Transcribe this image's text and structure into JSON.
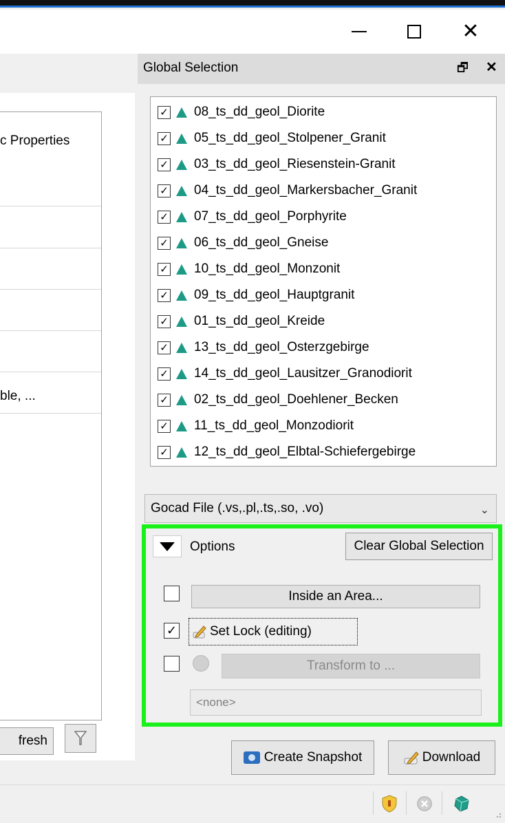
{
  "window": {
    "minimize_glyph": "",
    "maximize_glyph": "",
    "close_glyph": "✕"
  },
  "left_panel": {
    "header_text": "c Properties",
    "row_text": "ble, ...",
    "refresh_label": "fresh"
  },
  "dock": {
    "title": "Global Selection",
    "float_glyph": "🗗",
    "close_glyph": "✕"
  },
  "layers": [
    {
      "label": "08_ts_dd_geol_Diorite",
      "checked": true
    },
    {
      "label": "05_ts_dd_geol_Stolpener_Granit",
      "checked": true
    },
    {
      "label": "03_ts_dd_geol_Riesenstein-Granit",
      "checked": true
    },
    {
      "label": "04_ts_dd_geol_Markersbacher_Granit",
      "checked": true
    },
    {
      "label": "07_ts_dd_geol_Porphyrite",
      "checked": true
    },
    {
      "label": "06_ts_dd_geol_Gneise",
      "checked": true
    },
    {
      "label": "10_ts_dd_geol_Monzonit",
      "checked": true
    },
    {
      "label": "09_ts_dd_geol_Hauptgranit",
      "checked": true
    },
    {
      "label": "01_ts_dd_geol_Kreide",
      "checked": true
    },
    {
      "label": "13_ts_dd_geol_Osterzgebirge",
      "checked": true
    },
    {
      "label": "14_ts_dd_geol_Lausitzer_Granodiorit",
      "checked": true
    },
    {
      "label": "02_ts_dd_geol_Doehlener_Becken",
      "checked": true
    },
    {
      "label": "11_ts_dd_geol_Monzodiorit",
      "checked": true
    },
    {
      "label": "12_ts_dd_geol_Elbtal-Schiefergebirge",
      "checked": true
    }
  ],
  "format": {
    "selected": "Gocad File (.vs,.pl,.ts,.so, .vo)"
  },
  "options": {
    "label": "Options",
    "clear_label": "Clear Global Selection",
    "area_label": "Inside an Area...",
    "area_checked": false,
    "lock_label": "Set Lock (editing)",
    "lock_checked": true,
    "transform_label": "Transform to ...",
    "transform_checked": false,
    "crs_value": "<none>"
  },
  "actions": {
    "snapshot_label": "Create Snapshot",
    "download_label": "Download"
  },
  "colors": {
    "accent_green": "#1af01a",
    "layer_icon": "#1d9a86"
  }
}
